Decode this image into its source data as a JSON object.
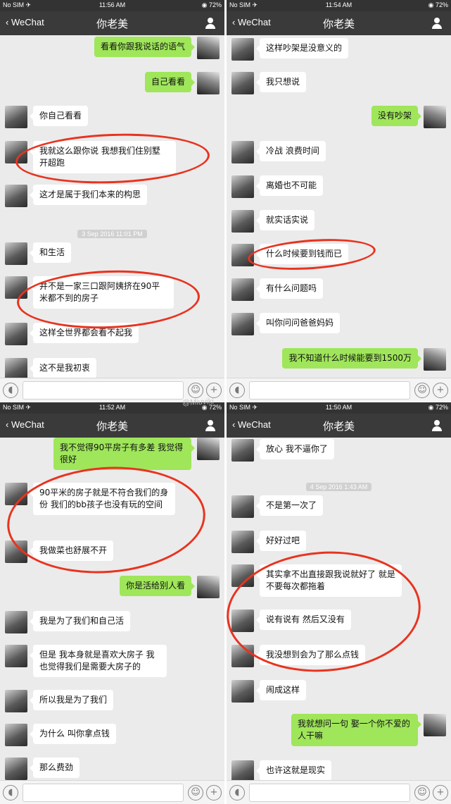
{
  "watermark": "@Miuviki",
  "panels": [
    {
      "status": {
        "carrier": "No SIM ✈︎",
        "time": "11:56 AM",
        "battery": "◉ 72%"
      },
      "nav": {
        "back": "WeChat",
        "title": "你老美"
      },
      "messages": [
        {
          "side": "out",
          "text": "看看你跟我说话的语气"
        },
        {
          "side": "out",
          "text": "自己看看"
        },
        {
          "side": "in",
          "text": "你自己看看"
        },
        {
          "side": "in",
          "text": "我就这么跟你说 我想我们住别墅 开超跑"
        },
        {
          "side": "in",
          "text": "这才是属于我们本来的构思"
        },
        {
          "type": "timestamp",
          "text": "3 Sep 2016 11:01 PM"
        },
        {
          "side": "in",
          "text": "和生活"
        },
        {
          "side": "in",
          "text": "并不是一家三口跟阿姨挤在90平米都不到的房子"
        },
        {
          "side": "in",
          "text": "这样全世界都会看不起我"
        },
        {
          "side": "in",
          "text": "这不是我初衷"
        }
      ]
    },
    {
      "status": {
        "carrier": "No SIM ✈︎",
        "time": "11:54 AM",
        "battery": "◉ 72%"
      },
      "nav": {
        "back": "WeChat",
        "title": "你老美"
      },
      "messages": [
        {
          "side": "in",
          "text": "这样吵架是没意义的"
        },
        {
          "side": "in",
          "text": "我只想说"
        },
        {
          "side": "out",
          "text": "没有吵架"
        },
        {
          "side": "in",
          "text": "冷战 浪费时间"
        },
        {
          "side": "in",
          "text": "离婚也不可能"
        },
        {
          "side": "in",
          "text": "就实话实说"
        },
        {
          "side": "in",
          "text": "什么时候要到钱而已"
        },
        {
          "side": "in",
          "text": "有什么问题吗"
        },
        {
          "side": "in",
          "text": "叫你问问爸爸妈妈"
        },
        {
          "side": "out",
          "text": "我不知道什么时候能要到1500万"
        }
      ]
    },
    {
      "status": {
        "carrier": "No SIM ✈︎",
        "time": "11:52 AM",
        "battery": "◉ 72%"
      },
      "nav": {
        "back": "WeChat",
        "title": "你老美"
      },
      "messages": [
        {
          "side": "out",
          "text": "我不觉得90平房子有多差 我觉得很好"
        },
        {
          "side": "in",
          "text": "90平米的房子就是不符合我们的身份 我们的bb孩子也没有玩的空间"
        },
        {
          "side": "in",
          "text": "我做菜也舒展不开"
        },
        {
          "side": "out",
          "text": "你是活给别人看"
        },
        {
          "side": "in",
          "text": "我是为了我们和自己活"
        },
        {
          "side": "in",
          "text": "但是 我本身就是喜欢大房子 我也觉得我们是需要大房子的"
        },
        {
          "side": "in",
          "text": "所以我是为了我们"
        },
        {
          "side": "in",
          "text": "为什么 叫你拿点钱"
        },
        {
          "side": "in",
          "text": "那么费劲"
        }
      ]
    },
    {
      "status": {
        "carrier": "No SIM ✈︎",
        "time": "11:50 AM",
        "battery": "◉ 72%"
      },
      "nav": {
        "back": "WeChat",
        "title": "你老美"
      },
      "messages": [
        {
          "side": "in",
          "text": "放心 我不逼你了"
        },
        {
          "type": "timestamp",
          "text": "4 Sep 2016 1:43 AM"
        },
        {
          "side": "in",
          "text": "不是第一次了"
        },
        {
          "side": "in",
          "text": "好好过吧"
        },
        {
          "side": "in",
          "text": "其实拿不出直接跟我说就好了 就是不要每次都拖着"
        },
        {
          "side": "in",
          "text": "说有说有 然后又没有"
        },
        {
          "side": "in",
          "text": "我没想到会为了那么点钱"
        },
        {
          "side": "in",
          "text": "闹成这样"
        },
        {
          "side": "out",
          "text": "我就想问一句 娶一个你不爱的人干嘛"
        },
        {
          "side": "in",
          "text": "也许这就是现实"
        }
      ]
    }
  ]
}
